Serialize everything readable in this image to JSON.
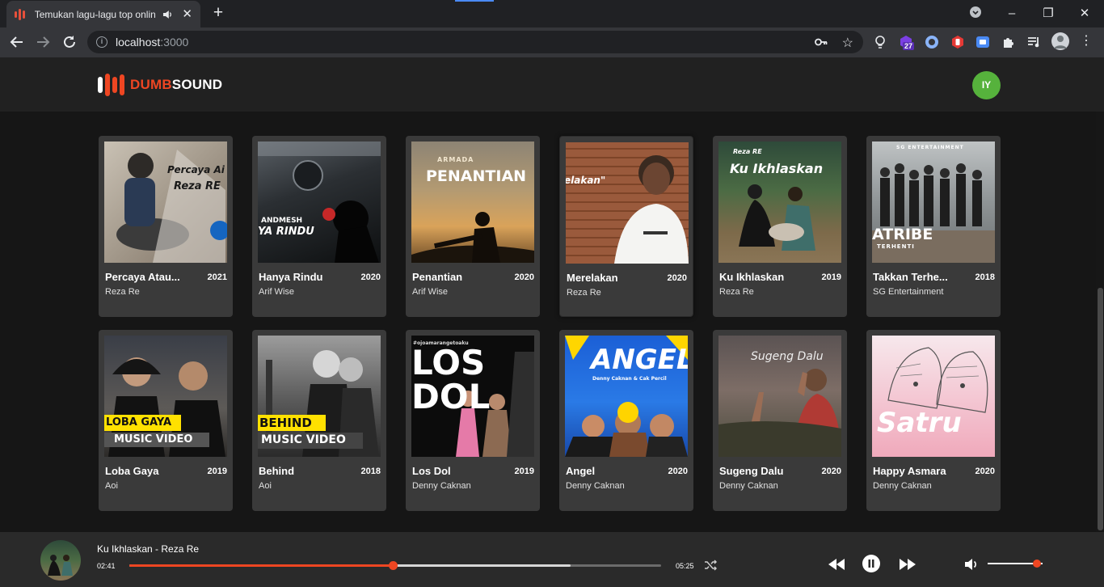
{
  "browser": {
    "tab_title": "Temukan lagu-lagu top online",
    "url_host": "localhost",
    "url_port": ":3000",
    "extension_badge": "27"
  },
  "app": {
    "logo_part1": "DUMB",
    "logo_part2": "SOUND",
    "avatar_initials": "IY",
    "accent_color": "#ee4622",
    "avatar_color": "#56b23c"
  },
  "songs": [
    {
      "title": "Percaya Atau...",
      "year": "2021",
      "artist": "Reza Re",
      "art_text": "Percaya Ai\nReza RE"
    },
    {
      "title": "Hanya Rindu",
      "year": "2020",
      "artist": "Arif Wise",
      "art_text": "ANDMESH\nYA RINDU"
    },
    {
      "title": "Penantian",
      "year": "2020",
      "artist": "Arif Wise",
      "art_text": "ARMADA\nPENANTIAN"
    },
    {
      "title": "Merelakan",
      "year": "2020",
      "artist": "Reza Re",
      "art_text": "elakan\""
    },
    {
      "title": "Ku Ikhlaskan",
      "year": "2019",
      "artist": "Reza Re",
      "art_text": "Reza RE\nKu Ikhlaskan"
    },
    {
      "title": "Takkan Terhe...",
      "year": "2018",
      "artist": "SG Entertainment",
      "art_text": "SG ENTERTAINMENT\nATRIBE\nTERHENTI"
    },
    {
      "title": "Loba Gaya",
      "year": "2019",
      "artist": "Aoi",
      "art_text": "LOBA GAYA\nMUSIC VIDEO"
    },
    {
      "title": "Behind",
      "year": "2018",
      "artist": "Aoi",
      "art_text": "BEHIND\nMUSIC VIDEO"
    },
    {
      "title": "Los Dol",
      "year": "2019",
      "artist": "Denny Caknan",
      "art_text": "LOS\nDOL"
    },
    {
      "title": "Angel",
      "year": "2020",
      "artist": "Denny Caknan",
      "art_text": "ANGEL\nDenny Caknan & Cak Percil"
    },
    {
      "title": "Sugeng Dalu",
      "year": "2020",
      "artist": "Denny Caknan",
      "art_text": "Sugeng Dalu"
    },
    {
      "title": "Happy Asmara",
      "year": "2020",
      "artist": "Denny Caknan",
      "art_text": "Satru"
    }
  ],
  "player": {
    "now_playing": "Ku Ikhlaskan - Reza Re",
    "current_time": "02:41",
    "duration": "05:25",
    "progress_fraction": 0.495,
    "buffer_fraction": 0.83,
    "volume_fraction": 0.9
  }
}
